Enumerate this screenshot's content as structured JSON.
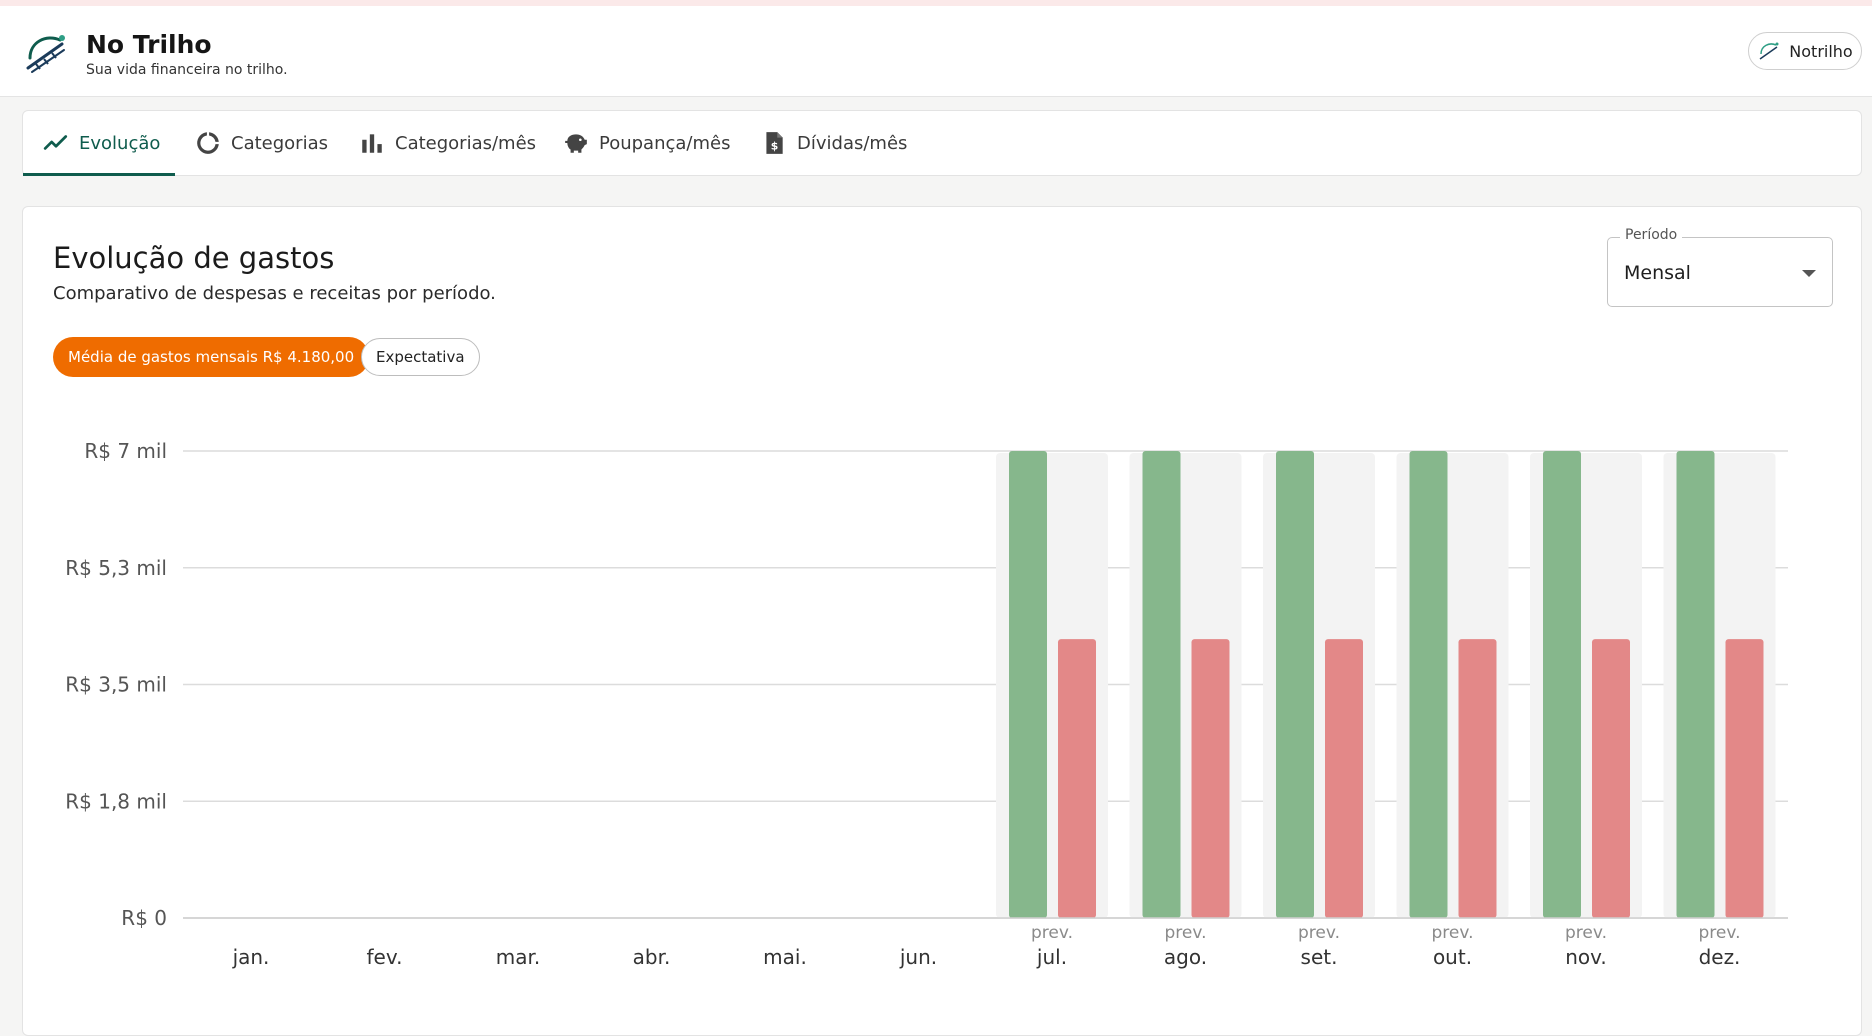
{
  "app": {
    "title": "No Trilho",
    "subtitle": "Sua vida financeira no trilho.",
    "user_label": "Notrilho"
  },
  "tabs": [
    {
      "label": "Evolução",
      "icon": "trending-up-icon",
      "active": true
    },
    {
      "label": "Categorias",
      "icon": "donut-icon",
      "active": false
    },
    {
      "label": "Categorias/mês",
      "icon": "bar-chart-icon",
      "active": false
    },
    {
      "label": "Poupança/mês",
      "icon": "piggy-bank-icon",
      "active": false
    },
    {
      "label": "Dívidas/mês",
      "icon": "invoice-icon",
      "active": false
    }
  ],
  "card": {
    "title": "Evolução de gastos",
    "subtitle": "Comparativo de despesas e receitas por período.",
    "chip_average": "Média de gastos mensais R$ 4.180,00",
    "chip_expectation": "Expectativa",
    "period_label": "Período",
    "period_value": "Mensal"
  },
  "colors": {
    "accent": "#0f5c4d",
    "orange": "#ef6c00",
    "income": "#86b78c",
    "expense": "#e38888",
    "forecast_bg": "#f3f3f3"
  },
  "chart_data": {
    "type": "bar",
    "categories": [
      "jan.",
      "fev.",
      "mar.",
      "abr.",
      "mai.",
      "jun.",
      "jul.",
      "ago.",
      "set.",
      "out.",
      "nov.",
      "dez."
    ],
    "forecast_label": "prev.",
    "forecast_flags": [
      false,
      false,
      false,
      false,
      false,
      false,
      true,
      true,
      true,
      true,
      true,
      true
    ],
    "series": [
      {
        "values": [
          0,
          0,
          0,
          0,
          0,
          0,
          7000,
          7000,
          7000,
          7000,
          7000,
          7000
        ]
      },
      {
        "values": [
          0,
          0,
          0,
          0,
          0,
          0,
          4180,
          4180,
          4180,
          4180,
          4180,
          4180
        ]
      }
    ],
    "yticks": [
      0,
      1750,
      3500,
      5250,
      7000
    ],
    "ytick_labels": [
      "R$ 0",
      "R$ 1,8 mil",
      "R$ 3,5 mil",
      "R$ 5,3 mil",
      "R$ 7 mil"
    ],
    "ylim": [
      0,
      7000
    ],
    "grid": true
  }
}
